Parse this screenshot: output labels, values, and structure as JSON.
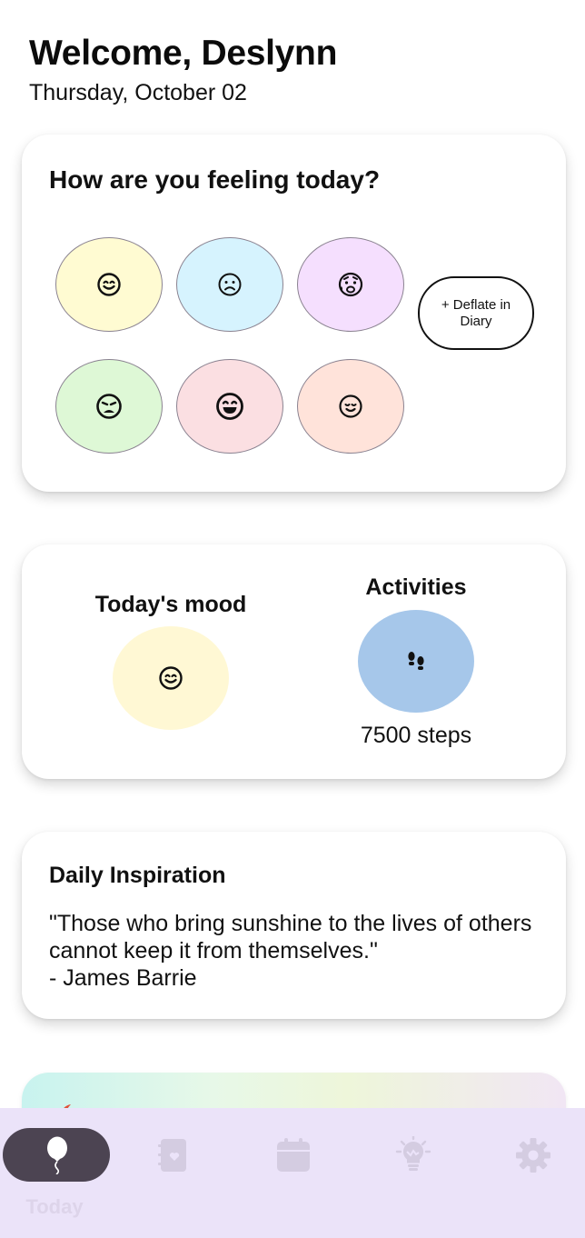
{
  "header": {
    "greeting": "Welcome, Deslynn",
    "date": "Thursday, October 02"
  },
  "feeling_card": {
    "title": "How are you feeling today?",
    "moods": [
      {
        "name": "happy",
        "color": "#fffbd2",
        "icon": "smile-icon"
      },
      {
        "name": "sad",
        "color": "#d6f3fe",
        "icon": "frown-icon"
      },
      {
        "name": "anxious",
        "color": "#f5dffe",
        "icon": "anxious-face-icon"
      },
      {
        "name": "tired",
        "color": "#def8d6",
        "icon": "weary-face-icon"
      },
      {
        "name": "excited",
        "color": "#fbdfe2",
        "icon": "grin-icon"
      },
      {
        "name": "content",
        "color": "#ffe3da",
        "icon": "content-face-icon"
      }
    ],
    "deflate_label": "+ Deflate in Diary"
  },
  "today_card": {
    "mood_title": "Today's mood",
    "mood_icon": "smile-icon",
    "activities_title": "Activities",
    "activity_icon": "footprints-icon",
    "steps": "7500 steps"
  },
  "inspiration": {
    "title": "Daily Inspiration",
    "quote": "\"Those who bring sunshine to the lives of others cannot keep it from themselves.\"",
    "author": "- James Barrie"
  },
  "bottom_nav": {
    "items": [
      {
        "label": "Today",
        "icon": "balloon-icon",
        "active": true
      },
      {
        "label": "Diary",
        "icon": "journal-icon",
        "active": false
      },
      {
        "label": "Calendar",
        "icon": "calendar-icon",
        "active": false
      },
      {
        "label": "Insights",
        "icon": "lightbulb-icon",
        "active": false
      },
      {
        "label": "Settings",
        "icon": "gear-icon",
        "active": false
      }
    ]
  }
}
